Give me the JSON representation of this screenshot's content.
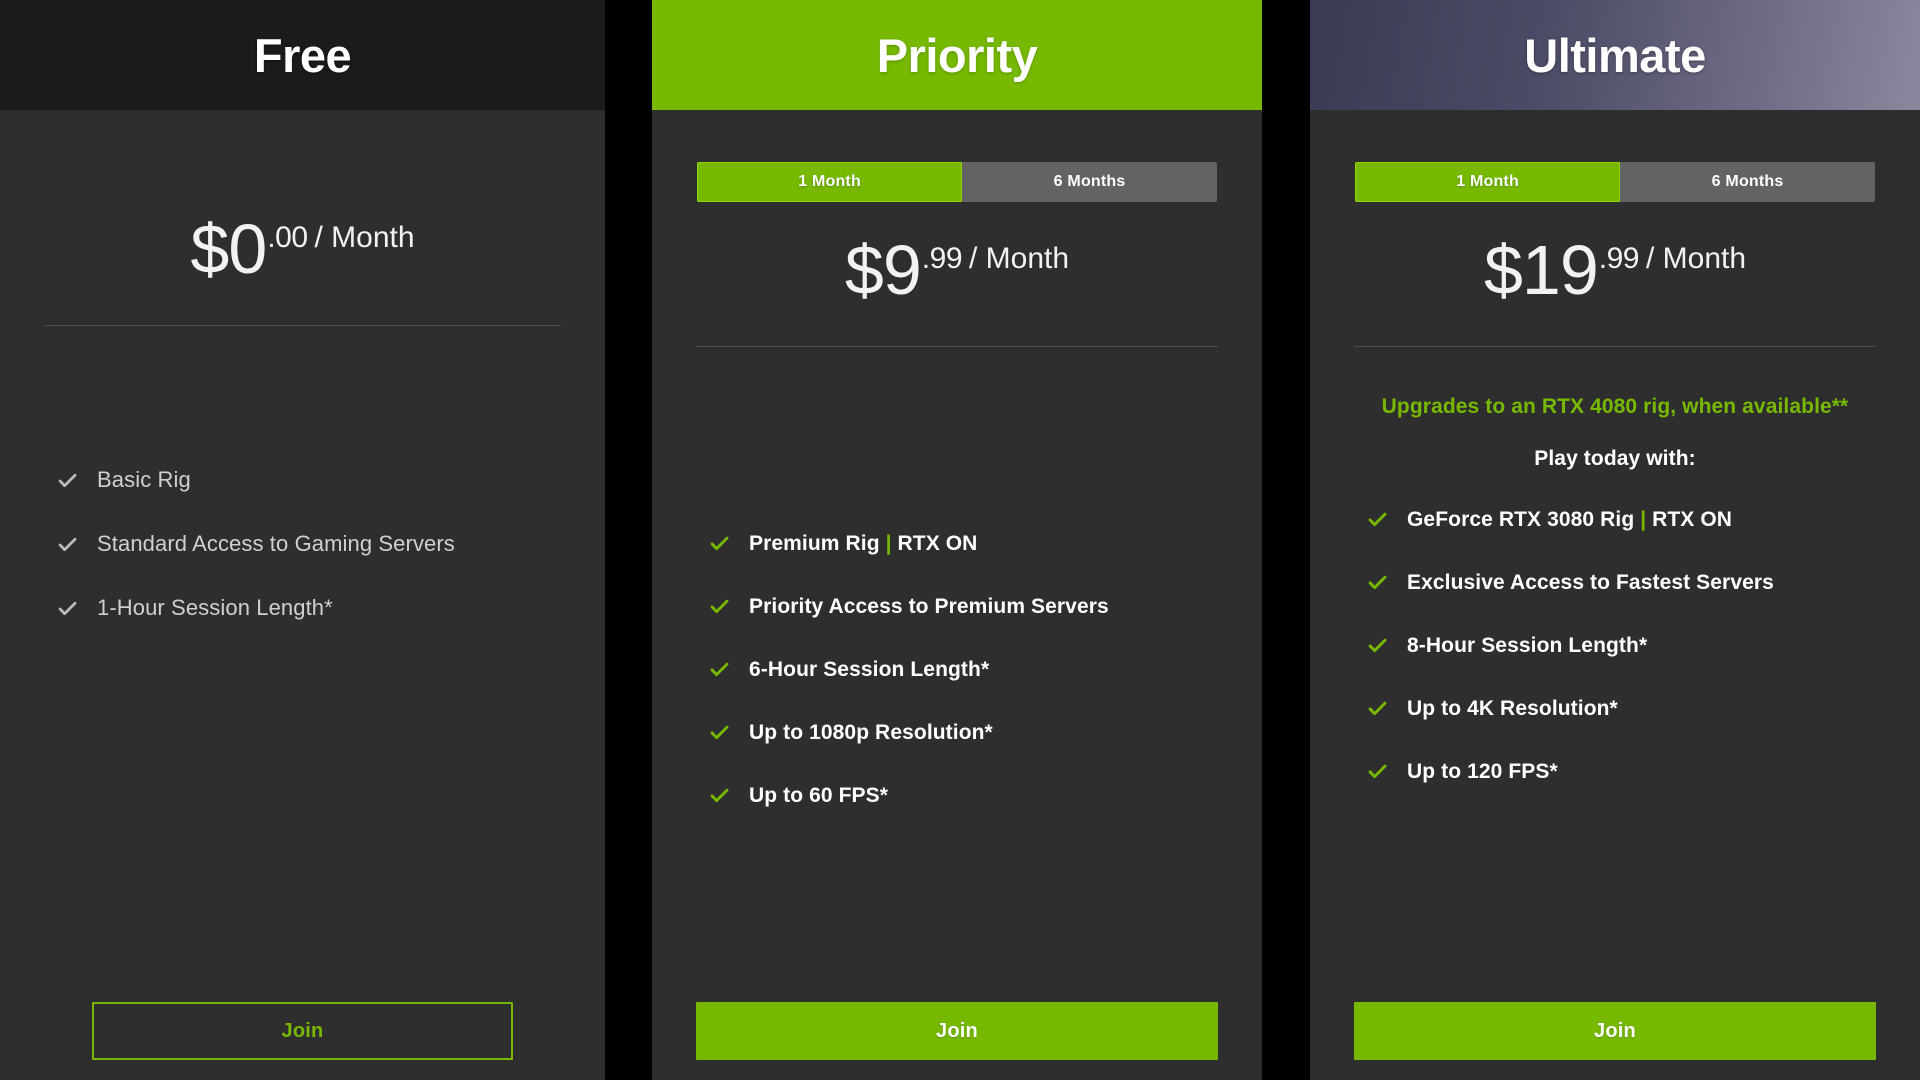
{
  "colors": {
    "brand_green": "#76b900",
    "card_bg": "#2e2e2e",
    "free_header_bg": "#1b1b1b",
    "inactive_segment": "#636363",
    "page_bg": "#000000"
  },
  "plans": [
    {
      "id": "free",
      "title": "Free",
      "header_style": "dark",
      "has_term_toggle": false,
      "price": {
        "currency_amount": "$0",
        "cents": ".00",
        "period": "/ Month"
      },
      "promo": null,
      "promo_sub": null,
      "features": [
        {
          "text": "Basic Rig"
        },
        {
          "text": "Standard Access to Gaming Servers"
        },
        {
          "text": "1-Hour Session Length*"
        }
      ],
      "cta": {
        "label": "Join",
        "style": "outline"
      }
    },
    {
      "id": "priority",
      "title": "Priority",
      "header_style": "green",
      "has_term_toggle": true,
      "terms": [
        {
          "label": "1 Month",
          "selected": true
        },
        {
          "label": "6 Months",
          "selected": false
        }
      ],
      "price": {
        "currency_amount": "$9",
        "cents": ".99",
        "period": "/ Month"
      },
      "promo": null,
      "promo_sub": null,
      "features": [
        {
          "text": "Premium Rig",
          "separator": "|",
          "text2": "RTX ON"
        },
        {
          "text": "Priority Access to Premium Servers"
        },
        {
          "text": "6-Hour Session Length*"
        },
        {
          "text": "Up to 1080p Resolution*"
        },
        {
          "text": "Up to 60 FPS*"
        }
      ],
      "cta": {
        "label": "Join",
        "style": "solid"
      }
    },
    {
      "id": "ultimate",
      "title": "Ultimate",
      "header_style": "gradient",
      "has_term_toggle": true,
      "terms": [
        {
          "label": "1 Month",
          "selected": true
        },
        {
          "label": "6 Months",
          "selected": false
        }
      ],
      "price": {
        "currency_amount": "$19",
        "cents": ".99",
        "period": "/ Month"
      },
      "promo": "Upgrades to an RTX 4080 rig, when available**",
      "promo_sub": "Play today with:",
      "features": [
        {
          "text": "GeForce RTX 3080 Rig",
          "separator": "|",
          "text2": "RTX ON"
        },
        {
          "text": "Exclusive Access to Fastest Servers"
        },
        {
          "text": "8-Hour Session Length*"
        },
        {
          "text": "Up to 4K Resolution*"
        },
        {
          "text": "Up to 120 FPS*"
        }
      ],
      "cta": {
        "label": "Join",
        "style": "solid"
      }
    }
  ]
}
